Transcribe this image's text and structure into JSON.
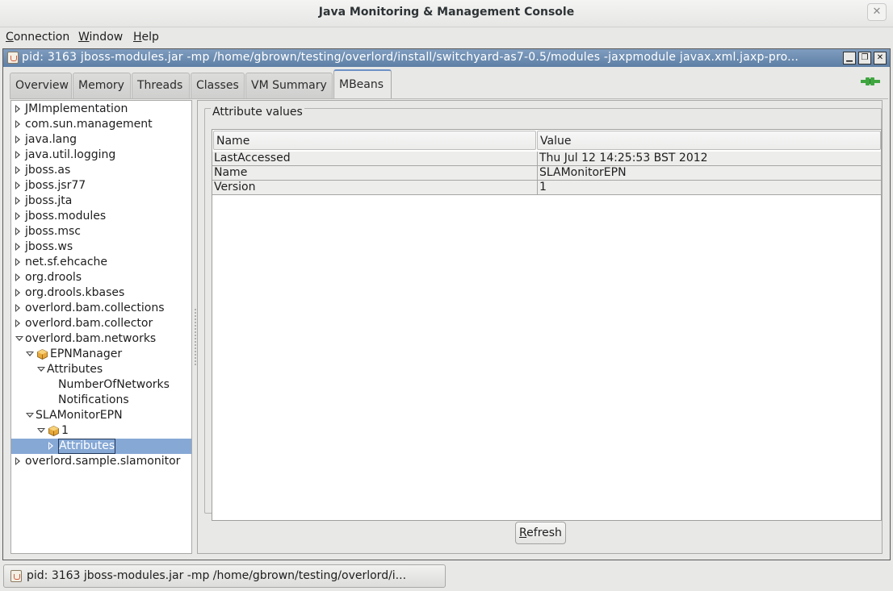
{
  "window": {
    "title": "Java Monitoring & Management Console",
    "close_glyph": "✕"
  },
  "menubar": [
    {
      "mnemonic": "C",
      "rest": "onnection"
    },
    {
      "mnemonic": "W",
      "rest": "indow"
    },
    {
      "mnemonic": "H",
      "rest": "elp"
    }
  ],
  "internal_frame": {
    "title": "pid: 3163 jboss-modules.jar -mp /home/gbrown/testing/overlord/install/switchyard-as7-0.5/modules -jaxpmodule javax.xml.jaxp-pro...",
    "buttons": [
      "▁",
      "❐",
      "✕"
    ]
  },
  "tabs": [
    {
      "label": "Overview",
      "active": false
    },
    {
      "label": "Memory",
      "active": false
    },
    {
      "label": "Threads",
      "active": false
    },
    {
      "label": "Classes",
      "active": false
    },
    {
      "label": "VM Summary",
      "active": false
    },
    {
      "label": "MBeans",
      "active": true
    }
  ],
  "tree": [
    {
      "label": "JMImplementation",
      "state": "collapsed",
      "icon": null
    },
    {
      "label": "com.sun.management",
      "state": "collapsed",
      "icon": null
    },
    {
      "label": "java.lang",
      "state": "collapsed",
      "icon": null
    },
    {
      "label": "java.util.logging",
      "state": "collapsed",
      "icon": null
    },
    {
      "label": "jboss.as",
      "state": "collapsed",
      "icon": null
    },
    {
      "label": "jboss.jsr77",
      "state": "collapsed",
      "icon": null
    },
    {
      "label": "jboss.jta",
      "state": "collapsed",
      "icon": null
    },
    {
      "label": "jboss.modules",
      "state": "collapsed",
      "icon": null
    },
    {
      "label": "jboss.msc",
      "state": "collapsed",
      "icon": null
    },
    {
      "label": "jboss.ws",
      "state": "collapsed",
      "icon": null
    },
    {
      "label": "net.sf.ehcache",
      "state": "collapsed",
      "icon": null
    },
    {
      "label": "org.drools",
      "state": "collapsed",
      "icon": null
    },
    {
      "label": "org.drools.kbases",
      "state": "collapsed",
      "icon": null
    },
    {
      "label": "overlord.bam.collections",
      "state": "collapsed",
      "icon": null
    },
    {
      "label": "overlord.bam.collector",
      "state": "collapsed",
      "icon": null
    },
    {
      "label": "overlord.bam.networks",
      "state": "expanded",
      "icon": null
    },
    {
      "label": "EPNManager",
      "state": "expanded",
      "icon": "mbean-icon"
    },
    {
      "label": "Attributes",
      "state": "expanded",
      "icon": null
    },
    {
      "label": "NumberOfNetworks",
      "state": "leaf",
      "icon": null
    },
    {
      "label": "Notifications",
      "state": "leaf",
      "icon": null
    },
    {
      "label": "SLAMonitorEPN",
      "state": "expanded",
      "icon": null
    },
    {
      "label": "1",
      "state": "expanded",
      "icon": "mbean-icon"
    },
    {
      "label": "Attributes",
      "state": "collapsed",
      "icon": null,
      "selected": true
    },
    {
      "label": "overlord.sample.slamonitor",
      "state": "collapsed",
      "icon": null
    }
  ],
  "attributes_panel": {
    "title": "Attribute values",
    "columns": [
      "Name",
      "Value"
    ],
    "rows": [
      [
        "LastAccessed",
        "Thu Jul 12 14:25:53 BST 2012"
      ],
      [
        "Name",
        "SLAMonitorEPN"
      ],
      [
        "Version",
        "1"
      ]
    ],
    "refresh_mnemonic": "R",
    "refresh_rest": "efresh"
  },
  "taskbar": {
    "item_label": "pid: 3163 jboss-modules.jar -mp /home/gbrown/testing/overlord/i..."
  },
  "colors": {
    "selection": "#86a8d5",
    "frame_title": "#6b8bb1",
    "connect_icon": "#3fa63f"
  }
}
